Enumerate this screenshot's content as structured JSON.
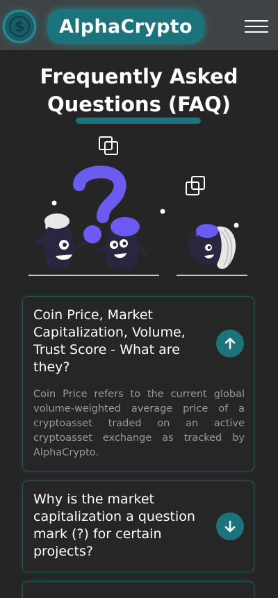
{
  "header": {
    "brand": "AlphaCrypto",
    "logo_symbol": "$",
    "logo_icon": "dollar-coin-icon",
    "menu_icon": "hamburger-menu-icon"
  },
  "page": {
    "title_line1": "Frequently Asked",
    "title_line2": "Questions (FAQ)"
  },
  "illustration": {
    "description_icon": "faq-characters-illustration"
  },
  "faq": [
    {
      "question": "Coin Price, Market Capitalization, Volume, Trust Score - What are they?",
      "answer": "Coin Price refers to the current global volume-weighted average price of a cryptoasset traded on an active cryptoasset exchange as tracked by AlphaCrypto.",
      "expanded": true,
      "toggle_icon": "arrow-up-icon"
    },
    {
      "question": "Why is the market capitalization a question mark (?) for certain projects?",
      "answer": "",
      "expanded": false,
      "toggle_icon": "arrow-down-icon"
    }
  ],
  "colors": {
    "background": "#252525",
    "header": "#3f4345",
    "accent": "#1b747c",
    "card_border": "#1d5a5f",
    "illustration_purple": "#6b5bf0",
    "illustration_dark": "#2a2640",
    "answer_text": "#9a9a9a"
  }
}
